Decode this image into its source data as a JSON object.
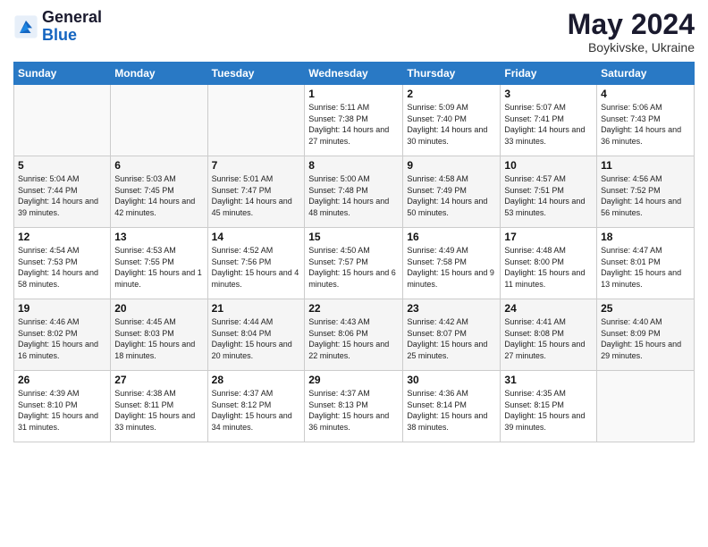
{
  "header": {
    "logo_line1": "General",
    "logo_line2": "Blue",
    "month_year": "May 2024",
    "location": "Boykivske, Ukraine"
  },
  "weekdays": [
    "Sunday",
    "Monday",
    "Tuesday",
    "Wednesday",
    "Thursday",
    "Friday",
    "Saturday"
  ],
  "weeks": [
    [
      {
        "day": "",
        "info": ""
      },
      {
        "day": "",
        "info": ""
      },
      {
        "day": "",
        "info": ""
      },
      {
        "day": "1",
        "info": "Sunrise: 5:11 AM\nSunset: 7:38 PM\nDaylight: 14 hours and 27 minutes."
      },
      {
        "day": "2",
        "info": "Sunrise: 5:09 AM\nSunset: 7:40 PM\nDaylight: 14 hours and 30 minutes."
      },
      {
        "day": "3",
        "info": "Sunrise: 5:07 AM\nSunset: 7:41 PM\nDaylight: 14 hours and 33 minutes."
      },
      {
        "day": "4",
        "info": "Sunrise: 5:06 AM\nSunset: 7:43 PM\nDaylight: 14 hours and 36 minutes."
      }
    ],
    [
      {
        "day": "5",
        "info": "Sunrise: 5:04 AM\nSunset: 7:44 PM\nDaylight: 14 hours and 39 minutes."
      },
      {
        "day": "6",
        "info": "Sunrise: 5:03 AM\nSunset: 7:45 PM\nDaylight: 14 hours and 42 minutes."
      },
      {
        "day": "7",
        "info": "Sunrise: 5:01 AM\nSunset: 7:47 PM\nDaylight: 14 hours and 45 minutes."
      },
      {
        "day": "8",
        "info": "Sunrise: 5:00 AM\nSunset: 7:48 PM\nDaylight: 14 hours and 48 minutes."
      },
      {
        "day": "9",
        "info": "Sunrise: 4:58 AM\nSunset: 7:49 PM\nDaylight: 14 hours and 50 minutes."
      },
      {
        "day": "10",
        "info": "Sunrise: 4:57 AM\nSunset: 7:51 PM\nDaylight: 14 hours and 53 minutes."
      },
      {
        "day": "11",
        "info": "Sunrise: 4:56 AM\nSunset: 7:52 PM\nDaylight: 14 hours and 56 minutes."
      }
    ],
    [
      {
        "day": "12",
        "info": "Sunrise: 4:54 AM\nSunset: 7:53 PM\nDaylight: 14 hours and 58 minutes."
      },
      {
        "day": "13",
        "info": "Sunrise: 4:53 AM\nSunset: 7:55 PM\nDaylight: 15 hours and 1 minute."
      },
      {
        "day": "14",
        "info": "Sunrise: 4:52 AM\nSunset: 7:56 PM\nDaylight: 15 hours and 4 minutes."
      },
      {
        "day": "15",
        "info": "Sunrise: 4:50 AM\nSunset: 7:57 PM\nDaylight: 15 hours and 6 minutes."
      },
      {
        "day": "16",
        "info": "Sunrise: 4:49 AM\nSunset: 7:58 PM\nDaylight: 15 hours and 9 minutes."
      },
      {
        "day": "17",
        "info": "Sunrise: 4:48 AM\nSunset: 8:00 PM\nDaylight: 15 hours and 11 minutes."
      },
      {
        "day": "18",
        "info": "Sunrise: 4:47 AM\nSunset: 8:01 PM\nDaylight: 15 hours and 13 minutes."
      }
    ],
    [
      {
        "day": "19",
        "info": "Sunrise: 4:46 AM\nSunset: 8:02 PM\nDaylight: 15 hours and 16 minutes."
      },
      {
        "day": "20",
        "info": "Sunrise: 4:45 AM\nSunset: 8:03 PM\nDaylight: 15 hours and 18 minutes."
      },
      {
        "day": "21",
        "info": "Sunrise: 4:44 AM\nSunset: 8:04 PM\nDaylight: 15 hours and 20 minutes."
      },
      {
        "day": "22",
        "info": "Sunrise: 4:43 AM\nSunset: 8:06 PM\nDaylight: 15 hours and 22 minutes."
      },
      {
        "day": "23",
        "info": "Sunrise: 4:42 AM\nSunset: 8:07 PM\nDaylight: 15 hours and 25 minutes."
      },
      {
        "day": "24",
        "info": "Sunrise: 4:41 AM\nSunset: 8:08 PM\nDaylight: 15 hours and 27 minutes."
      },
      {
        "day": "25",
        "info": "Sunrise: 4:40 AM\nSunset: 8:09 PM\nDaylight: 15 hours and 29 minutes."
      }
    ],
    [
      {
        "day": "26",
        "info": "Sunrise: 4:39 AM\nSunset: 8:10 PM\nDaylight: 15 hours and 31 minutes."
      },
      {
        "day": "27",
        "info": "Sunrise: 4:38 AM\nSunset: 8:11 PM\nDaylight: 15 hours and 33 minutes."
      },
      {
        "day": "28",
        "info": "Sunrise: 4:37 AM\nSunset: 8:12 PM\nDaylight: 15 hours and 34 minutes."
      },
      {
        "day": "29",
        "info": "Sunrise: 4:37 AM\nSunset: 8:13 PM\nDaylight: 15 hours and 36 minutes."
      },
      {
        "day": "30",
        "info": "Sunrise: 4:36 AM\nSunset: 8:14 PM\nDaylight: 15 hours and 38 minutes."
      },
      {
        "day": "31",
        "info": "Sunrise: 4:35 AM\nSunset: 8:15 PM\nDaylight: 15 hours and 39 minutes."
      },
      {
        "day": "",
        "info": ""
      }
    ]
  ]
}
